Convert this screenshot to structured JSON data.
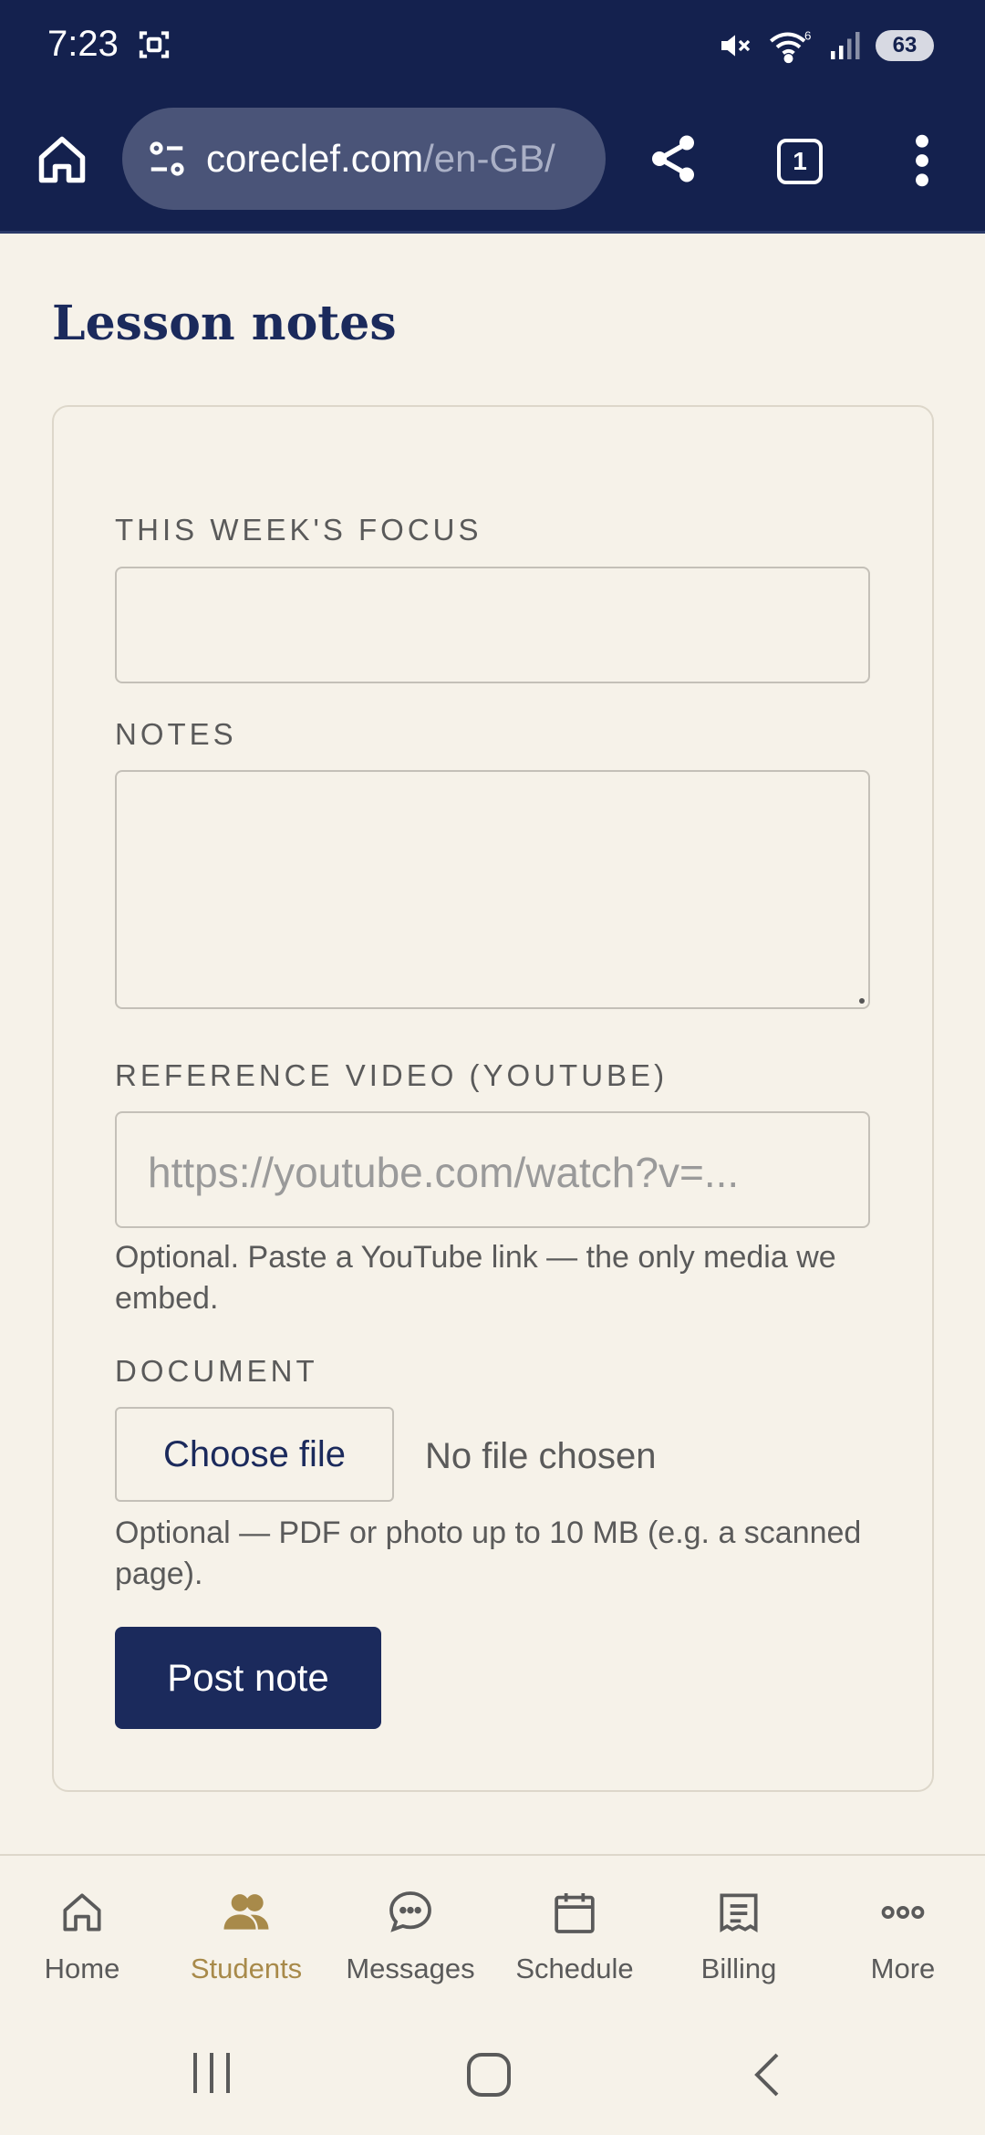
{
  "status": {
    "time": "7:23",
    "battery": "63",
    "wifi_badge": "6"
  },
  "browser": {
    "url_main": "coreclef.com",
    "url_dim": "/en-GB/",
    "tab_count": "1"
  },
  "page": {
    "title": "Lesson notes"
  },
  "form": {
    "focus_label": "THIS WEEK'S FOCUS",
    "focus_value": "",
    "notes_label": "NOTES",
    "notes_value": "",
    "video_label": "REFERENCE VIDEO (YOUTUBE)",
    "video_placeholder": "https://youtube.com/watch?v=...",
    "video_help": "Optional. Paste a YouTube link — the only media we embed.",
    "document_label": "DOCUMENT",
    "choose_file": "Choose file",
    "no_file": "No file chosen",
    "document_help": "Optional — PDF or photo up to 10 MB (e.g. a scanned page).",
    "submit": "Post note"
  },
  "nav": {
    "items": [
      {
        "label": "Home",
        "icon": "home-icon"
      },
      {
        "label": "Students",
        "icon": "students-icon",
        "active": true
      },
      {
        "label": "Messages",
        "icon": "messages-icon"
      },
      {
        "label": "Schedule",
        "icon": "calendar-icon"
      },
      {
        "label": "Billing",
        "icon": "receipt-icon"
      },
      {
        "label": "More",
        "icon": "more-icon"
      }
    ]
  },
  "colors": {
    "brand_navy": "#1b2a5c",
    "bar_navy": "#14214e",
    "accent_gold": "#a88a4a",
    "background": "#f6f2e9"
  }
}
